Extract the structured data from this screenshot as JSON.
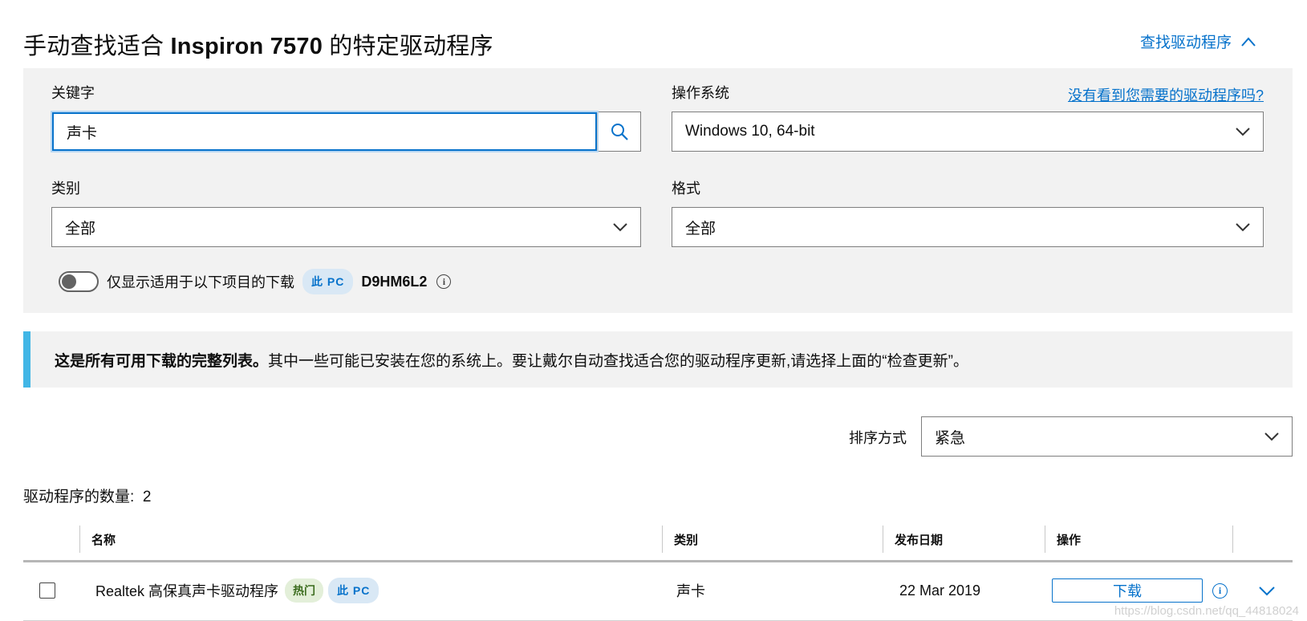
{
  "header": {
    "title_prefix": "手动查找适合",
    "title_model": "Inspiron 7570",
    "title_suffix": "的特定驱动程序",
    "collapse_link": "查找驱动程序"
  },
  "filters": {
    "keyword_label": "关键字",
    "keyword_value": "声卡",
    "os_label": "操作系统",
    "os_value": "Windows 10, 64-bit",
    "help_link": "没有看到您需要的驱动程序吗?",
    "category_label": "类别",
    "category_value": "全部",
    "format_label": "格式",
    "format_value": "全部",
    "device_toggle_label": "仅显示适用于以下项目的下载",
    "pc_badge": "此 PC",
    "service_tag": "D9HM6L2",
    "info_glyph": "i"
  },
  "notice": {
    "bold": "这是所有可用下载的完整列表。",
    "text": "其中一些可能已安装在您的系统上。要让戴尔自动查找适合您的驱动程序更新,请选择上面的“检查更新”。",
    "accent_color": "#41b6e6"
  },
  "sort": {
    "label": "排序方式",
    "value": "紧急"
  },
  "count": {
    "label": "驱动程序的数量:",
    "value": "2"
  },
  "table": {
    "headers": {
      "name": "名称",
      "category": "类别",
      "date": "发布日期",
      "action": "操作"
    },
    "rows": [
      {
        "name": "Realtek 高保真声卡驱动程序",
        "hot_badge": "热门",
        "pc_badge": "此 PC",
        "category": "声卡",
        "date": "22 Mar 2019",
        "action": "下载"
      }
    ]
  },
  "watermark": "https://blog.csdn.net/qq_44818024",
  "colors": {
    "link": "#0672cb",
    "panel_bg": "#f2f2f2",
    "badge_bg": "#d9e8f5",
    "hot_bg": "#e3efd9"
  }
}
